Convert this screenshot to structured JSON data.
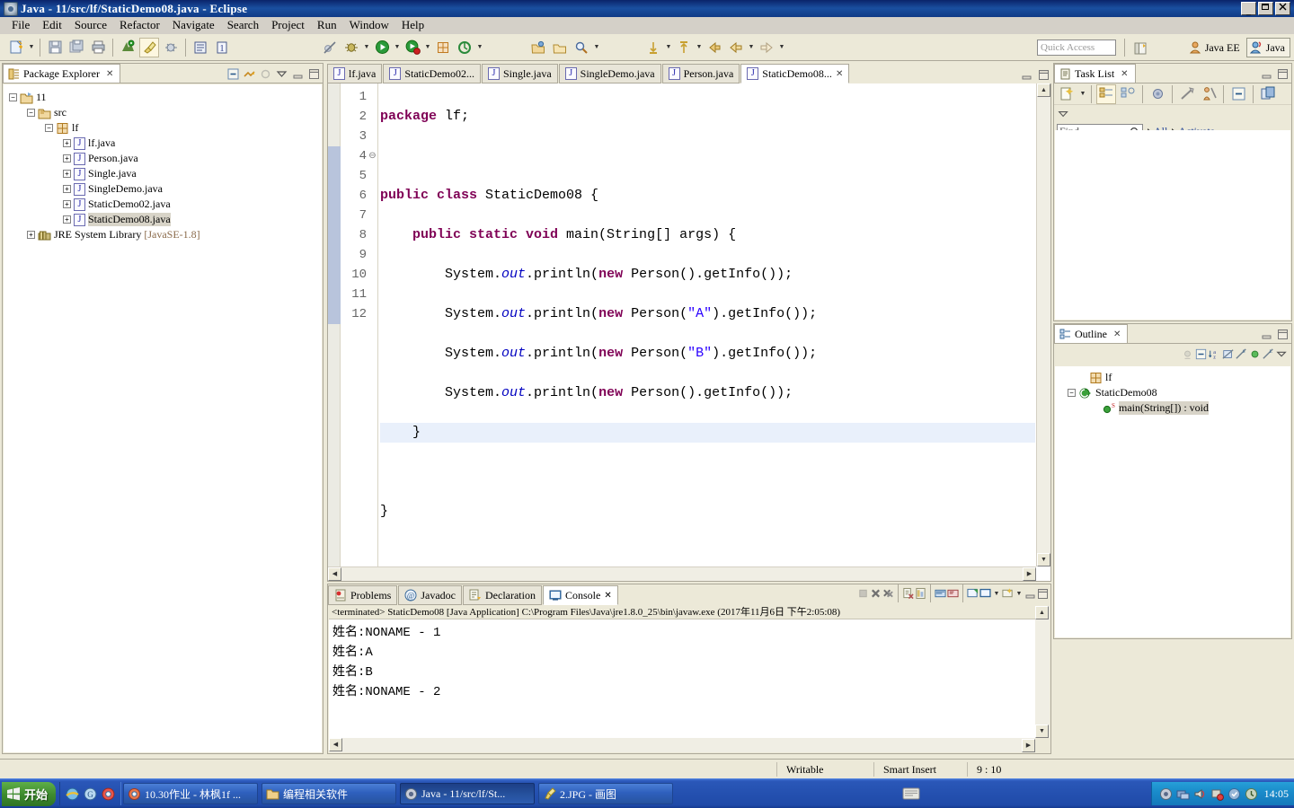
{
  "window": {
    "title": "Java - 11/src/lf/StaticDemo08.java - Eclipse",
    "icon": "eclipse-icon",
    "minimize": "_",
    "maximize": "❐",
    "close": "✕"
  },
  "menubar": {
    "items": [
      {
        "label": "File"
      },
      {
        "label": "Edit"
      },
      {
        "label": "Source"
      },
      {
        "label": "Refactor"
      },
      {
        "label": "Navigate"
      },
      {
        "label": "Search"
      },
      {
        "label": "Project"
      },
      {
        "label": "Run"
      },
      {
        "label": "Window"
      },
      {
        "label": "Help"
      }
    ]
  },
  "toolbar": {
    "quick_access_placeholder": "Quick Access",
    "perspective_java_ee": "Java EE",
    "perspective_java": "Java"
  },
  "package_explorer": {
    "tab_label": "Package Explorer",
    "tree": [
      {
        "label": "11",
        "indent": 0,
        "expander": "-",
        "icon": "project-icon"
      },
      {
        "label": "src",
        "indent": 1,
        "expander": "-",
        "icon": "source-folder-icon"
      },
      {
        "label": "lf",
        "indent": 2,
        "expander": "-",
        "icon": "package-icon"
      },
      {
        "label": "lf.java",
        "indent": 3,
        "expander": "+",
        "icon": "java-file-icon"
      },
      {
        "label": "Person.java",
        "indent": 3,
        "expander": "+",
        "icon": "java-file-icon"
      },
      {
        "label": "Single.java",
        "indent": 3,
        "expander": "+",
        "icon": "java-file-icon"
      },
      {
        "label": "SingleDemo.java",
        "indent": 3,
        "expander": "+",
        "icon": "java-file-icon"
      },
      {
        "label": "StaticDemo02.java",
        "indent": 3,
        "expander": "+",
        "icon": "java-file-icon"
      },
      {
        "label": "StaticDemo08.java",
        "indent": 3,
        "expander": "+",
        "icon": "java-file-icon",
        "selected": true
      },
      {
        "label": "JRE System Library",
        "suffix": "[JavaSE-1.8]",
        "indent": 1,
        "expander": "+",
        "icon": "library-icon"
      }
    ]
  },
  "editor": {
    "tabs": [
      {
        "label": "lf.java",
        "selected": false
      },
      {
        "label": "StaticDemo02...",
        "selected": false
      },
      {
        "label": "Single.java",
        "selected": false
      },
      {
        "label": "SingleDemo.java",
        "selected": false
      },
      {
        "label": "Person.java",
        "selected": false
      },
      {
        "label": "StaticDemo08...",
        "selected": true
      }
    ],
    "line_numbers": [
      "1",
      "2",
      "3",
      "4",
      "5",
      "6",
      "7",
      "8",
      "9",
      "10",
      "11",
      "12"
    ],
    "highlighted_line": 9,
    "folding_line": 4,
    "lines": [
      {
        "n": 1,
        "text": "package lf;"
      },
      {
        "n": 2,
        "text": ""
      },
      {
        "n": 3,
        "text": "public class StaticDemo08 {"
      },
      {
        "n": 4,
        "text": "    public static void main(String[] args) {"
      },
      {
        "n": 5,
        "text": "        System.out.println(new Person().getInfo());"
      },
      {
        "n": 6,
        "text": "        System.out.println(new Person(\"A\").getInfo());"
      },
      {
        "n": 7,
        "text": "        System.out.println(new Person(\"B\").getInfo());"
      },
      {
        "n": 8,
        "text": "        System.out.println(new Person().getInfo());"
      },
      {
        "n": 9,
        "text": "    }"
      },
      {
        "n": 10,
        "text": ""
      },
      {
        "n": 11,
        "text": "}"
      },
      {
        "n": 12,
        "text": ""
      }
    ]
  },
  "console": {
    "tabs": [
      {
        "label": "Problems",
        "icon": "problems-icon",
        "selected": false
      },
      {
        "label": "Javadoc",
        "icon": "javadoc-icon",
        "selected": false
      },
      {
        "label": "Declaration",
        "icon": "declaration-icon",
        "selected": false
      },
      {
        "label": "Console",
        "icon": "console-icon",
        "selected": true
      }
    ],
    "launch_header": "<terminated> StaticDemo08 [Java Application] C:\\Program Files\\Java\\jre1.8.0_25\\bin\\javaw.exe (2017年11月6日 下午2:05:08)",
    "output": [
      "姓名:NONAME - 1",
      "姓名:A",
      "姓名:B",
      "姓名:NONAME - 2"
    ]
  },
  "task_list": {
    "tab_label": "Task List",
    "find_placeholder": "Find",
    "filter_all": "All",
    "filter_activate": "Activate..."
  },
  "outline": {
    "tab_label": "Outline",
    "tree": [
      {
        "label": "lf",
        "indent": 0,
        "icon": "package-icon",
        "expander": ""
      },
      {
        "label": "StaticDemo08",
        "indent": 0,
        "icon": "class-icon",
        "expander": "-"
      },
      {
        "label": "main(String[]) : void",
        "indent": 1,
        "icon": "method-public-static-icon",
        "expander": "",
        "selected": true
      }
    ]
  },
  "statusbar": {
    "writable": "Writable",
    "insert_mode": "Smart Insert",
    "cursor_position": "9 : 10"
  },
  "taskbar": {
    "start": "开始",
    "tasks": [
      {
        "label": "10.30作业 - 林枫1f ...",
        "icon": "chrome-icon",
        "active": false
      },
      {
        "label": "编程相关软件",
        "icon": "folder-icon",
        "active": false
      },
      {
        "label": "Java - 11/src/lf/St...",
        "icon": "eclipse-icon",
        "active": true
      },
      {
        "label": "2.JPG - 画图",
        "icon": "paint-icon",
        "active": false
      }
    ],
    "clock": "14:05"
  },
  "colors": {
    "title_bar": "#0a246a",
    "chrome": "#ece9d8",
    "keyword": "#7f0055",
    "string": "#2a00ff",
    "field": "#0000c0",
    "line_highlight": "#e9f0fb",
    "taskbar": "#1f4aa8"
  }
}
